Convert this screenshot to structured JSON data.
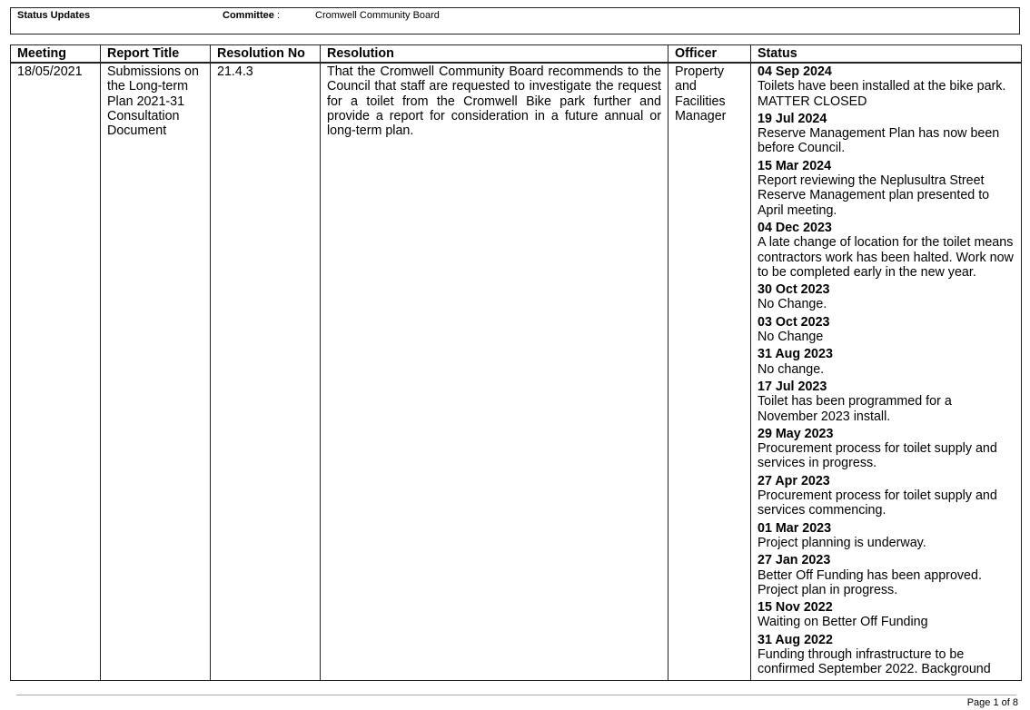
{
  "header": {
    "status_label": "Status Updates",
    "committee_label": "Committee",
    "committee_colon": ":",
    "committee_value": "Cromwell Community Board"
  },
  "table": {
    "columns": [
      "Meeting",
      "Report Title",
      "Resolution No",
      "Resolution",
      "Officer",
      "Status"
    ],
    "row": {
      "meeting": "18/05/2021",
      "report_title": "Submissions on the Long-term Plan 2021-31 Consultation Document",
      "resolution_no": "21.4.3",
      "resolution": "That the Cromwell Community Board recommends to the Council that staff are requested to investigate the request for a toilet from the Cromwell Bike park further and provide a report for consideration in a future annual or long-term plan.",
      "officer": "Property and Facilities Manager",
      "status_entries": [
        {
          "date": "04 Sep 2024",
          "text": "Toilets have been installed at the bike park.\nMATTER CLOSED"
        },
        {
          "date": "19 Jul 2024",
          "text": "Reserve Management Plan has now been before Council."
        },
        {
          "date": "15 Mar 2024",
          "text": "Report reviewing the Neplusultra Street Reserve Management plan presented to April meeting."
        },
        {
          "date": "04 Dec 2023",
          "text": "A late change of location for the toilet means contractors work has been halted.  Work now to be completed early in the new year."
        },
        {
          "date": "30 Oct 2023",
          "text": "No Change."
        },
        {
          "date": "03 Oct 2023",
          "text": "No Change"
        },
        {
          "date": "31 Aug 2023",
          "text": "No change."
        },
        {
          "date": "17 Jul 2023",
          "text": "Toilet has been programmed for a November 2023 install."
        },
        {
          "date": "29 May 2023",
          "text": "Procurement process for toilet supply and services in progress."
        },
        {
          "date": "27 Apr 2023",
          "text": "Procurement process for toilet supply and services commencing."
        },
        {
          "date": "01 Mar 2023",
          "text": "Project planning is underway."
        },
        {
          "date": "27 Jan 2023",
          "text": "Better Off Funding has been approved.\nProject plan in progress."
        },
        {
          "date": "15 Nov 2022",
          "text": "Waiting on Better Off Funding"
        },
        {
          "date": "31 Aug 2022",
          "text": "Funding through infrastructure to be confirmed September 2022.  Background"
        }
      ]
    }
  },
  "footer": {
    "page": "Page 1 of 8"
  }
}
